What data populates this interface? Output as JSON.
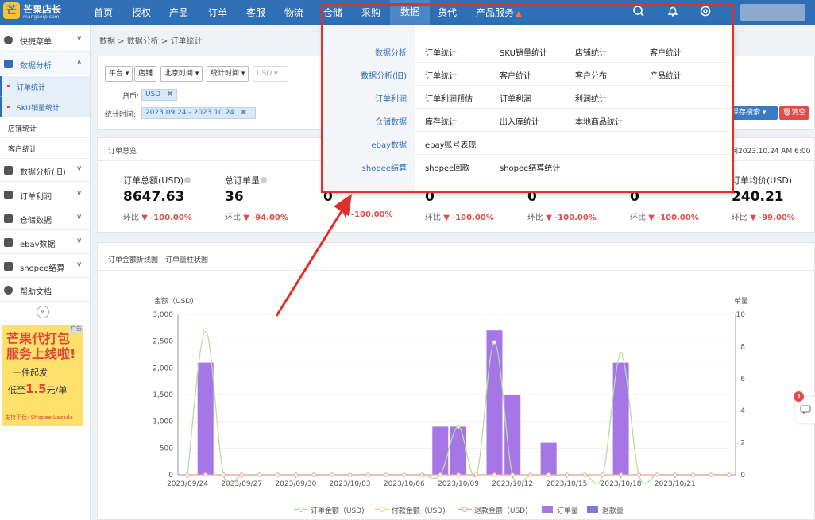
{
  "brand": {
    "name": "芒果店长",
    "domain": "mangoerp.com"
  },
  "topnav": {
    "items": [
      "首页",
      "授权",
      "产品",
      "订单",
      "客服",
      "物流",
      "仓储",
      "采购",
      "数据",
      "货代",
      "产品服务"
    ],
    "active": "数据"
  },
  "sidebar": {
    "items": [
      {
        "label": "快捷菜单",
        "icon": "gauge-icon"
      },
      {
        "label": "数据分析",
        "icon": "table-icon"
      },
      {
        "label": "数据分析(旧)",
        "icon": "table-icon"
      },
      {
        "label": "订单利润",
        "icon": "table-icon"
      },
      {
        "label": "仓储数据",
        "icon": "table-icon"
      },
      {
        "label": "ebay数据",
        "icon": "table-icon"
      },
      {
        "label": "shopee结算",
        "icon": "table-icon"
      },
      {
        "label": "帮助文档",
        "icon": "help-icon"
      }
    ],
    "subitems": [
      "订单统计",
      "SKU销量统计",
      "店铺统计",
      "客户统计"
    ],
    "collapse_symbol": "«"
  },
  "ad": {
    "tag": "广告",
    "line1": "芒果代打包",
    "line2": "服务上线啦!",
    "line3": "一件起发",
    "price_prefix": "低至",
    "price": "1.5",
    "price_suffix": "元/单",
    "platforms": "支持平台: Shopee Lazada"
  },
  "breadcrumb": [
    "数据",
    "数据分析",
    "订单统计"
  ],
  "filters": {
    "platform": "平台",
    "shop": "店铺",
    "timezone": "北京时间",
    "time_type": "统计时间",
    "currency_select": "USD",
    "currency_label": "货币:",
    "currency_tag": "USD",
    "range_label": "统计时间:",
    "range_tag": "2023.09.24 - 2023.10.24",
    "save_search": "保存搜索",
    "clear": "清空"
  },
  "overview": {
    "title": "订单总览",
    "updated": "更新时间2023.10.24 AM 6:00",
    "stats": [
      {
        "title": "订单总额(USD)",
        "value": "8647.63",
        "cmp_label": "环比",
        "pct": "-100.00%"
      },
      {
        "title": "总订单量",
        "value": "36",
        "cmp_label": "环比",
        "pct": "-94.00%"
      },
      {
        "title": "",
        "value": "0",
        "cmp_label": "",
        "pct": "-100.00%"
      },
      {
        "title": "",
        "value": "0",
        "cmp_label": "环比",
        "pct": "-100.00%"
      },
      {
        "title": "",
        "value": "0",
        "cmp_label": "环比",
        "pct": "-100.00%"
      },
      {
        "title": "",
        "value": "0",
        "cmp_label": "环比",
        "pct": "-100.00%"
      },
      {
        "title": "订单均价(USD)",
        "value": "240.21",
        "cmp_label": "环比",
        "pct": "-99.00%"
      }
    ]
  },
  "chart_tabs": [
    "订单金额折线图",
    "订单量柱状图"
  ],
  "dropdown": {
    "rows": [
      {
        "category": "数据分析",
        "links": [
          "订单统计",
          "SKU销量统计",
          "店铺统计",
          "客户统计"
        ]
      },
      {
        "category": "数据分析(旧)",
        "links": [
          "订单统计",
          "客户统计",
          "客户分布",
          "产品统计"
        ]
      },
      {
        "category": "订单利润",
        "links": [
          "订单利润预估",
          "订单利润",
          "利润统计"
        ]
      },
      {
        "category": "仓储数据",
        "links": [
          "库存统计",
          "出入库统计",
          "本地商品统计"
        ]
      },
      {
        "category": "ebay数据",
        "links": [
          "ebay账号表现"
        ]
      },
      {
        "category": "shopee结算",
        "links": [
          "shopee回款",
          "shopee结算统计"
        ]
      }
    ]
  },
  "chat_badge": "3",
  "chart_data": {
    "type": "bar",
    "xlabel": "",
    "ylabel": "金额（USD)",
    "y2label": "单量",
    "ylim": [
      0,
      3000
    ],
    "y2lim": [
      0,
      10
    ],
    "yticks": [
      "0",
      "500",
      "1,000",
      "1,500",
      "2,000",
      "2,500",
      "3,000"
    ],
    "y2ticks": [
      "0",
      "2",
      "4",
      "6",
      "8",
      "10"
    ],
    "xticks": [
      "2023/09/24",
      "2023/09/27",
      "2023/09/30",
      "2023/10/03",
      "2023/10/06",
      "2023/10/09",
      "2023/10/12",
      "2023/10/15",
      "2023/10/18",
      "2023/10/21"
    ],
    "categories": [
      "2023/09/24",
      "2023/09/25",
      "2023/09/26",
      "2023/09/27",
      "2023/09/28",
      "2023/09/29",
      "2023/09/30",
      "2023/10/01",
      "2023/10/02",
      "2023/10/03",
      "2023/10/04",
      "2023/10/05",
      "2023/10/06",
      "2023/10/07",
      "2023/10/08",
      "2023/10/09",
      "2023/10/10",
      "2023/10/11",
      "2023/10/12",
      "2023/10/13",
      "2023/10/14",
      "2023/10/15",
      "2023/10/16",
      "2023/10/17",
      "2023/10/18",
      "2023/10/19",
      "2023/10/20",
      "2023/10/21",
      "2023/10/22",
      "2023/10/23",
      "2023/10/24"
    ],
    "series": [
      {
        "name": "订单金额（USD)",
        "kind": "line",
        "color": "#b5dca0",
        "values": [
          0,
          2700,
          0,
          0,
          0,
          0,
          0,
          0,
          0,
          0,
          0,
          0,
          0,
          0,
          0,
          900,
          0,
          2480,
          0,
          0,
          0,
          0,
          0,
          0,
          2250,
          0,
          0,
          0,
          0,
          0,
          0
        ]
      },
      {
        "name": "付款金额（USD)",
        "kind": "line",
        "color": "#f2d37a",
        "values": [
          0,
          0,
          0,
          0,
          0,
          0,
          0,
          0,
          0,
          0,
          0,
          0,
          0,
          0,
          0,
          0,
          0,
          0,
          0,
          0,
          0,
          0,
          0,
          0,
          0,
          0,
          0,
          0,
          0,
          0,
          0
        ]
      },
      {
        "name": "退款金额（USD)",
        "kind": "line",
        "color": "#f0a3a3",
        "values": [
          0,
          0,
          0,
          0,
          0,
          0,
          0,
          0,
          0,
          0,
          0,
          0,
          0,
          0,
          0,
          0,
          0,
          0,
          0,
          0,
          0,
          0,
          0,
          0,
          0,
          0,
          0,
          0,
          0,
          0,
          0
        ]
      },
      {
        "name": "订单量",
        "kind": "bar",
        "color": "#a675e6",
        "values": [
          0,
          7,
          0,
          0,
          0,
          0,
          0,
          0,
          0,
          0,
          0,
          0,
          0,
          0,
          3,
          3,
          0,
          9,
          5,
          0,
          2,
          0,
          0,
          0,
          7,
          0,
          0,
          0,
          0,
          0,
          0
        ]
      },
      {
        "name": "退款量",
        "kind": "bar",
        "color": "#7c7bd6",
        "values": [
          0,
          0,
          0,
          0,
          0,
          0,
          0,
          0,
          0,
          0,
          0,
          0,
          0,
          0,
          0,
          0,
          0,
          0,
          0,
          0,
          0,
          0,
          0,
          0,
          0,
          0,
          0,
          0,
          0,
          0,
          0
        ]
      }
    ]
  }
}
